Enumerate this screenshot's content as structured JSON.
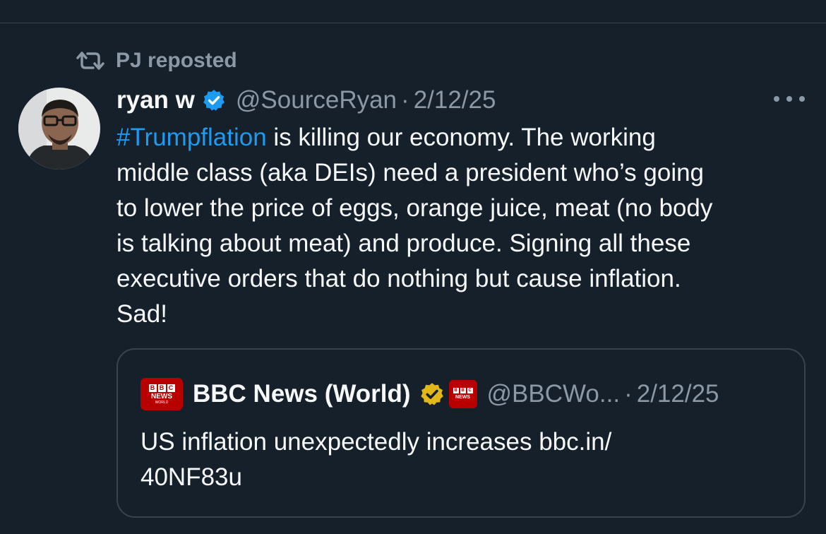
{
  "repost": {
    "icon": "repost-icon",
    "label": "PJ reposted"
  },
  "tweet": {
    "author_name": "ryan w",
    "verified_icon": "verified-badge-icon",
    "handle": "@SourceRyan",
    "separator": "·",
    "date": "2/12/25",
    "more_icon": "more-options-icon",
    "hashtag": "#Trumpflation",
    "text_lines": [
      " is killing our economy. The working",
      "middle class (aka DEIs) need a president who’s going",
      "to lower the price of eggs, orange juice, meat (no body",
      "is talking about meat) and produce. Signing all these",
      "executive orders that do nothing but cause inflation.",
      "Sad!"
    ]
  },
  "quote": {
    "logo_letters": [
      "B",
      "B",
      "C"
    ],
    "logo_word": "NEWS",
    "logo_sub": "WORLD",
    "author_name": "BBC News (World)",
    "gold_badge_icon": "gold-verified-badge-icon",
    "affiliate_icon": "bbc-affiliate-icon",
    "handle": "@BBCWo...",
    "separator": "·",
    "date": "2/12/25",
    "text_lines": [
      "US inflation unexpectedly increases bbc.in/",
      "40NF83u"
    ]
  },
  "colors": {
    "background": "#15202b",
    "text": "#f7f9f9",
    "secondary": "#8b98a5",
    "link": "#1d9bf0",
    "verified": "#1d9bf0",
    "gold_badge": "#e2b719",
    "bbc_red": "#b80000",
    "border": "#38444d"
  }
}
